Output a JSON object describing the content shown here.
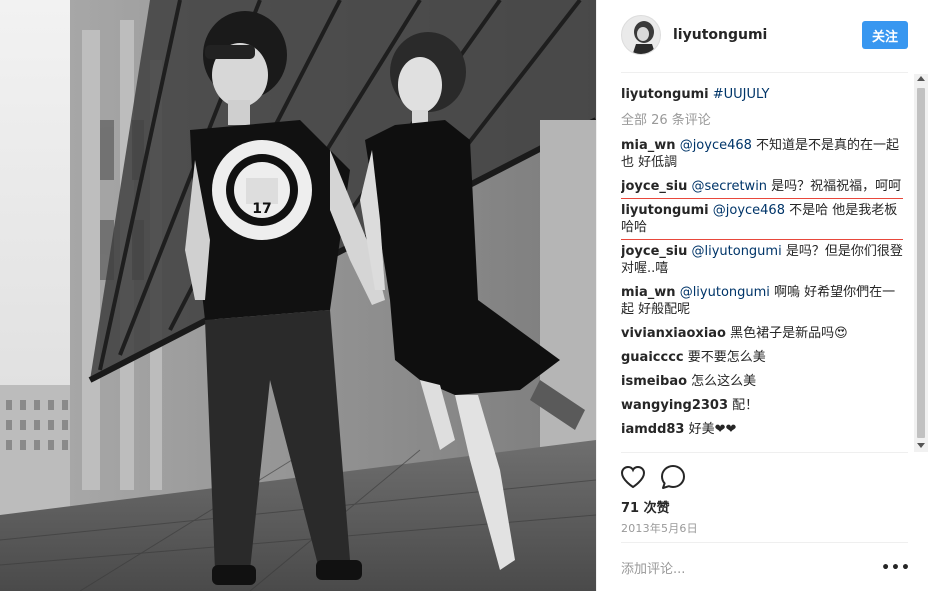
{
  "post": {
    "author": "liyutongumi",
    "follow_label": "关注"
  },
  "caption": {
    "user": "liyutongumi",
    "hashtag": "#UUJULY"
  },
  "all_comments_label": "全部 26 条评论",
  "comments": [
    {
      "user": "mia_wn",
      "mention": "@joyce468",
      "text": " 不知道是不是真的在一起也 好低調"
    },
    {
      "user": "joyce_siu",
      "mention": "@secretwin",
      "text": " 是吗？祝福祝福，呵呵"
    },
    {
      "user": "liyutongumi",
      "mention": "@joyce468",
      "text": " 不是哈 他是我老板哈哈"
    },
    {
      "user": "joyce_siu",
      "mention": "@liyutongumi",
      "text": " 是吗？但是你们很登对喔..嘻"
    },
    {
      "user": "mia_wn",
      "mention": "@liyutongumi",
      "text": " 啊嗚 好希望你們在一起 好般配呢"
    },
    {
      "user": "vivianxiaoxiao",
      "mention": "",
      "text": " 黑色裙子是新品吗😍"
    },
    {
      "user": "guaicccc",
      "mention": "",
      "text": " 要不要怎么美"
    },
    {
      "user": "ismeibao",
      "mention": "",
      "text": " 怎么这么美"
    },
    {
      "user": "wangying2303",
      "mention": "",
      "text": " 配！"
    },
    {
      "user": "iamdd83",
      "mention": "",
      "text": " 好美❤❤"
    }
  ],
  "likes_label": "71 次赞",
  "date_label": "2013年5月6日",
  "comment_placeholder": "添加评论...",
  "more_label": "•••",
  "colors": {
    "accent": "#3897f0",
    "link": "#003569",
    "highlight_box": "#e8473b"
  },
  "icons": {
    "like": "heart-icon",
    "comment": "comment-bubble-icon",
    "more": "more-dots-icon"
  }
}
